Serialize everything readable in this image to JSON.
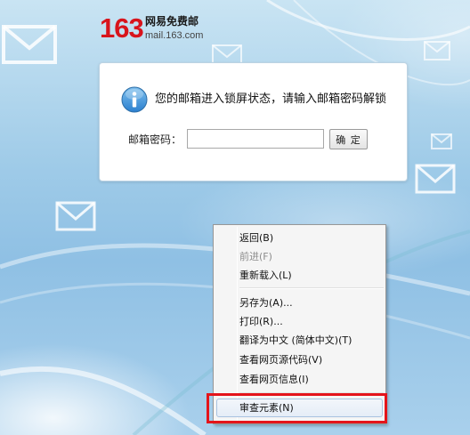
{
  "brand": {
    "logo_number": "163",
    "logo_name": "网易免费邮",
    "logo_url": "mail.163.com",
    "accent_color": "#d8141c"
  },
  "lock_panel": {
    "icon": "info-icon",
    "message": "您的邮箱进入锁屏状态，请输入邮箱密码解锁",
    "password_label": "邮箱密码：",
    "password_value": "",
    "confirm_label": "确 定"
  },
  "context_menu": {
    "items": [
      {
        "label": "返回(B)",
        "enabled": true
      },
      {
        "label": "前进(F)",
        "enabled": false
      },
      {
        "label": "重新载入(L)",
        "enabled": true
      },
      {
        "label": "另存为(A)...",
        "enabled": true
      },
      {
        "label": "打印(R)...",
        "enabled": true
      },
      {
        "label": "翻译为中文 (简体中文)(T)",
        "enabled": true
      },
      {
        "label": "查看网页源代码(V)",
        "enabled": true
      },
      {
        "label": "查看网页信息(I)",
        "enabled": true
      },
      {
        "label": "审查元素(N)",
        "enabled": true,
        "hovered": true
      }
    ]
  },
  "annotation": {
    "highlight_color": "#e4141b",
    "highlighted_item": "审查元素(N)"
  }
}
